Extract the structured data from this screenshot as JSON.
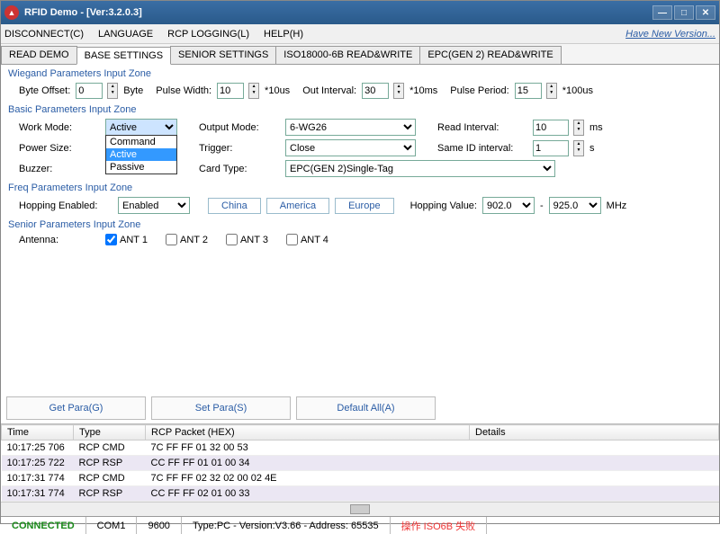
{
  "window": {
    "title": "RFID Demo - [Ver:3.2.0.3]"
  },
  "menu": {
    "disconnect": "DISCONNECT(C)",
    "language": "LANGUAGE",
    "rcp": "RCP LOGGING(L)",
    "help": "HELP(H)",
    "newver": "Have New Version..."
  },
  "tabs": {
    "read_demo": "READ DEMO",
    "base": "BASE SETTINGS",
    "senior": "SENIOR SETTINGS",
    "iso": "ISO18000-6B READ&WRITE",
    "epc": "EPC(GEN 2) READ&WRITE"
  },
  "wiegand": {
    "title": "Wiegand Parameters Input Zone",
    "byte_offset_lbl": "Byte Offset:",
    "byte_offset": "0",
    "byte": "Byte",
    "pulse_width_lbl": "Pulse Width:",
    "pulse_width": "10",
    "u10us": "*10us",
    "out_interval_lbl": "Out Interval:",
    "out_interval": "30",
    "u10ms": "*10ms",
    "pulse_period_lbl": "Pulse Period:",
    "pulse_period": "15",
    "u100us": "*100us"
  },
  "basic": {
    "title": "Basic Parameters Input Zone",
    "work_mode_lbl": "Work Mode:",
    "work_mode": "Active",
    "work_opts": {
      "cmd": "Command",
      "act": "Active",
      "pas": "Passive"
    },
    "output_mode_lbl": "Output Mode:",
    "output_mode": "6-WG26",
    "read_interval_lbl": "Read Interval:",
    "read_interval": "10",
    "ms": "ms",
    "power_lbl": "Power Size:",
    "trigger_lbl": "Trigger:",
    "trigger": "Close",
    "sameid_lbl": "Same ID interval:",
    "sameid": "1",
    "s": "s",
    "buzzer_lbl": "Buzzer:",
    "card_type_lbl": "Card Type:",
    "card_type": "EPC(GEN 2)Single-Tag"
  },
  "freq": {
    "title": "Freq Parameters Input Zone",
    "hop_en_lbl": "Hopping Enabled:",
    "hop_en": "Enabled",
    "china": "China",
    "america": "America",
    "europe": "Europe",
    "hop_val_lbl": "Hopping Value:",
    "f1": "902.0",
    "dash": "-",
    "f2": "925.0",
    "mhz": "MHz"
  },
  "senior_sec": {
    "title": "Senior Parameters Input Zone",
    "antenna_lbl": "Antenna:",
    "a1": "ANT 1",
    "a2": "ANT 2",
    "a3": "ANT 3",
    "a4": "ANT 4"
  },
  "buttons": {
    "get": "Get Para(G)",
    "set": "Set Para(S)",
    "def": "Default All(A)"
  },
  "table": {
    "h_time": "Time",
    "h_type": "Type",
    "h_pkt": "RCP Packet (HEX)",
    "h_det": "Details",
    "rows": [
      {
        "time": "10:17:25 706",
        "type": "RCP CMD",
        "pkt": "7C FF FF 01 32 00 53"
      },
      {
        "time": "10:17:25 722",
        "type": "RCP RSP",
        "pkt": "CC FF FF 01 01 00 34"
      },
      {
        "time": "10:17:31 774",
        "type": "RCP CMD",
        "pkt": "7C FF FF 02 32 02 00 02 4E"
      },
      {
        "time": "10:17:31 774",
        "type": "RCP RSP",
        "pkt": "CC FF FF 02 01 00 33"
      }
    ]
  },
  "status": {
    "conn": "CONNECTED",
    "port": "COM1",
    "baud": "9600",
    "ver": "Type:PC - Version:V3.66 - Address: 65535",
    "err": "操作 ISO6B 失败"
  }
}
